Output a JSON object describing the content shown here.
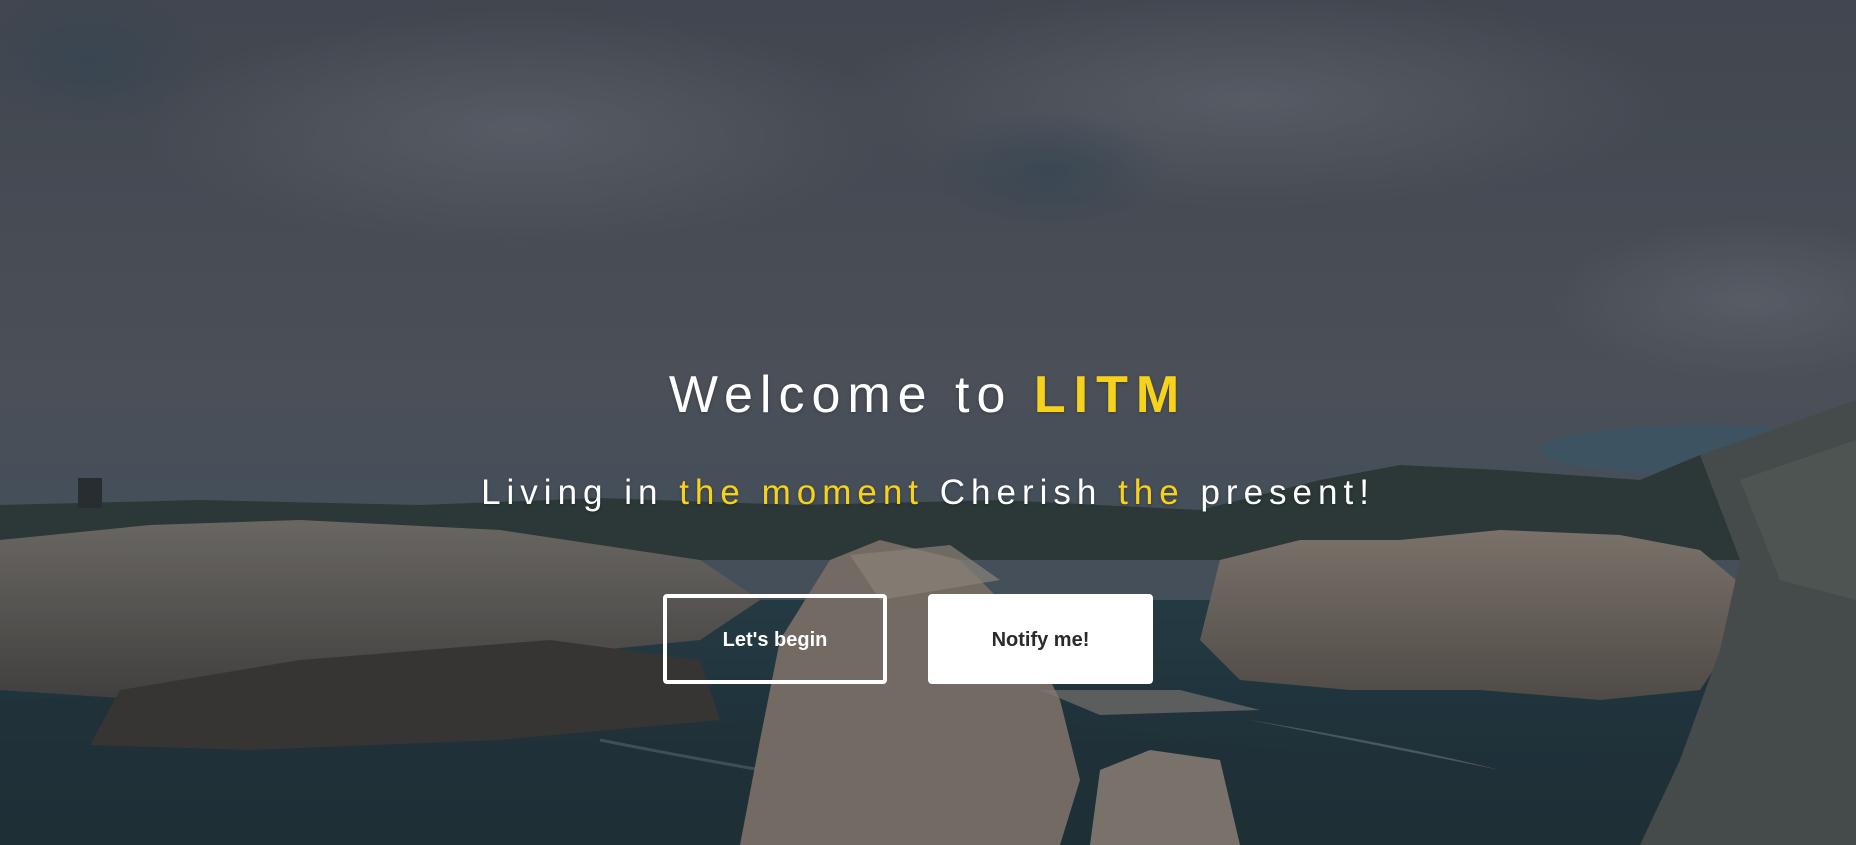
{
  "hero": {
    "title_prefix": "Welcome to ",
    "title_brand": "LITM",
    "subtitle": {
      "part1": "Living in ",
      "part2": "the moment",
      "part3": " Cherish ",
      "part4": "the",
      "part5": " present!"
    },
    "buttons": {
      "begin_label": "Let's begin",
      "notify_label": "Notify me!"
    }
  },
  "colors": {
    "accent": "#f7d21b",
    "text": "#ffffff",
    "button_dark_text": "#2a2a2a"
  }
}
